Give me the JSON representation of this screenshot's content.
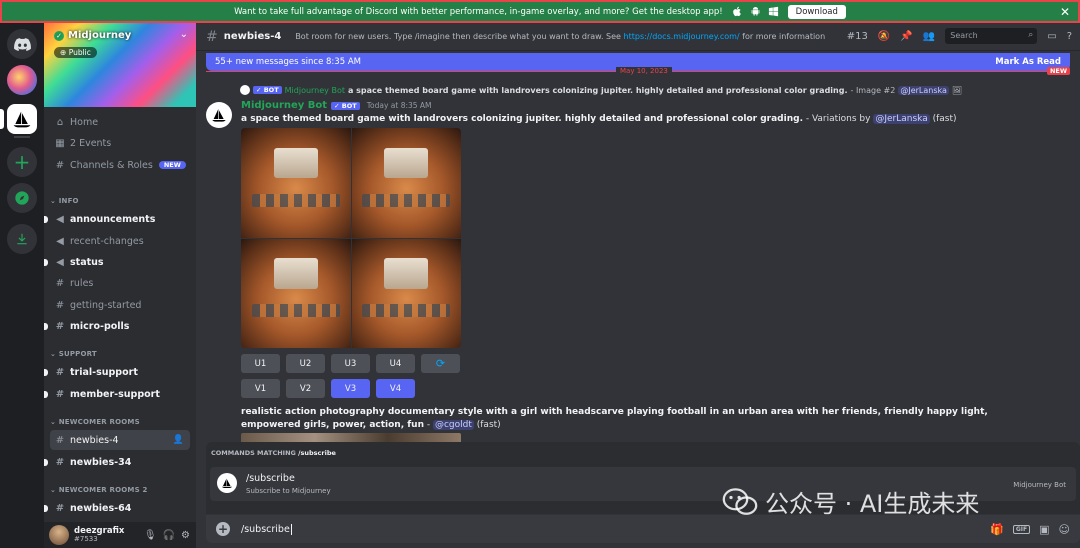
{
  "banner": {
    "text": "Want to take full advantage of Discord with better performance, in-game overlay, and more? Get the desktop app!",
    "download_label": "Download",
    "close_label": "✕"
  },
  "server": {
    "name": "Midjourney",
    "public_label": "Public"
  },
  "nav": {
    "home": "Home",
    "events": "2 Events",
    "channels_roles": "Channels & Roles",
    "new_badge": "NEW"
  },
  "categories": {
    "info": "INFO",
    "support": "SUPPORT",
    "newcomer": "NEWCOMER ROOMS",
    "newcomer2": "NEWCOMER ROOMS 2"
  },
  "channels": {
    "announcements": "announcements",
    "recent_changes": "recent-changes",
    "status": "status",
    "rules": "rules",
    "getting_started": "getting-started",
    "micro_polls": "micro-polls",
    "trial_support": "trial-support",
    "member_support": "member-support",
    "newbies_4": "newbies-4",
    "newbies_34": "newbies-34",
    "newbies_64": "newbies-64"
  },
  "user": {
    "name": "deezgrafix",
    "tag": "#7533"
  },
  "header": {
    "channel": "newbies-4",
    "topic_before": "Bot room for new users. Type /imagine then describe what you want to draw. See ",
    "topic_link": "https://docs.midjourney.com/",
    "topic_after": " for more information",
    "threads_count": "13",
    "search_placeholder": "Search"
  },
  "new_messages": {
    "text": "55+ new messages since 8:35 AM",
    "mark_read": "Mark As Read"
  },
  "divider": {
    "date": "May 10, 2023",
    "new_label": "NEW"
  },
  "reply": {
    "bot_label": "BOT",
    "author": "Midjourney Bot",
    "prompt": "a space themed board game with landrovers colonizing jupiter. highly detailed and professional color grading.",
    "suffix": " - Image #2 ",
    "mention": "@JerLanska"
  },
  "message": {
    "author": "Midjourney Bot",
    "bot_label": "BOT",
    "time": "Today at 8:35 AM",
    "prompt": "a space themed board game with landrovers colonizing jupiter. highly detailed and professional color grading.",
    "suffix": " - Variations by ",
    "mention": "@JerLanska",
    "mode": " (fast)"
  },
  "buttons": {
    "row1": [
      "U1",
      "U2",
      "U3",
      "U4"
    ],
    "row2": [
      "V1",
      "V2",
      "V3",
      "V4"
    ],
    "selected": [
      "V3",
      "V4"
    ]
  },
  "message2": {
    "prompt": "realistic action photography documentary style with a girl with headscarve playing football in an urban area with her friends, friendly happy light, empowered girls, power, action, fun",
    "dash": " - ",
    "mention": "@cgoldt",
    "mode": " (fast)"
  },
  "commands": {
    "title_prefix": "COMMANDS MATCHING ",
    "query": "/subscribe",
    "item_name": "/subscribe",
    "item_desc": "Subscribe to Midjourney",
    "item_source": "Midjourney Bot"
  },
  "input": {
    "value": "/subscribe",
    "gif_label": "GIF"
  },
  "watermark": {
    "text": "公众号 · AI生成未来"
  },
  "colors": {
    "banner_green": "#248046",
    "blurple": "#5865f2",
    "bot_green": "#23a559",
    "link_blue": "#00a8fc",
    "alert_red": "#e8434b"
  }
}
